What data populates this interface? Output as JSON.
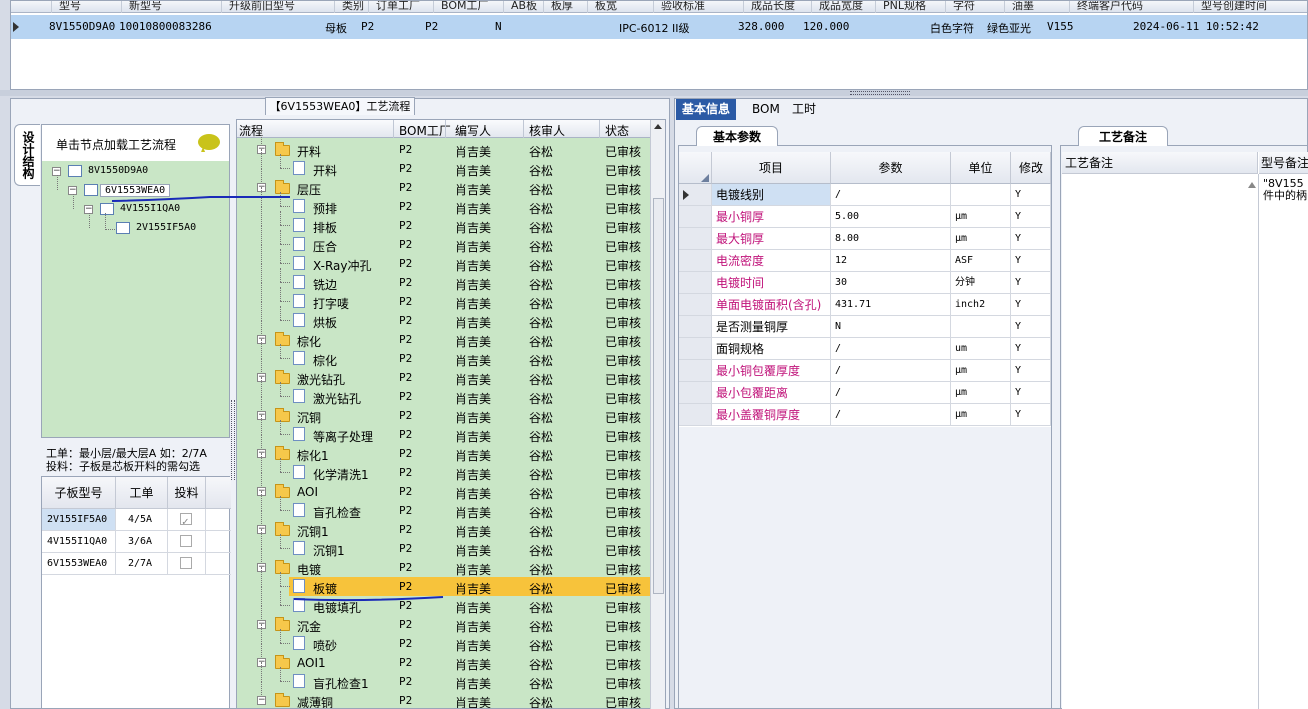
{
  "top_grid": {
    "headers": [
      "型号",
      "新型号",
      "升级前旧型号",
      "类别",
      "订单工厂",
      "BOM工厂",
      "AB板",
      "板厚",
      "板宽",
      "验收标准",
      "成品长度",
      "成品宽度",
      "PNL规格",
      "字符",
      "油墨",
      "终端客户代码",
      "型号创建时间"
    ],
    "row": {
      "model": "8V1550D9A0",
      "new_model": "10010800083286",
      "category": "母板",
      "order_factory": "P2",
      "bom_factory": "P2",
      "ab": "N",
      "standard": "IPC-6012 II级",
      "length": "328.000",
      "width": "120.000",
      "char": "白色字符",
      "ink": "绿色亚光",
      "customer": "V155",
      "created": "2024-06-11 10:52:42"
    }
  },
  "process_tab_title": "【6V1553WEA0】工艺流程",
  "structure_tab": "设计结构",
  "tree": {
    "header": "单击节点加载工艺流程",
    "nodes": [
      "8V1550D9A0",
      "6V1553WEA0",
      "4V155I1QA0",
      "2V155IF5A0"
    ]
  },
  "info_text": [
    "工单：最小层/最大层A 如：2/7A",
    "投料：子板是芯板开料的需勾选"
  ],
  "sub_grid": {
    "headers": [
      "子板型号",
      "工单",
      "投料"
    ],
    "rows": [
      {
        "model": "2V155IF5A0",
        "order": "4/5A",
        "feed": true
      },
      {
        "model": "4V155I1QA0",
        "order": "3/6A",
        "feed": false
      },
      {
        "model": "6V1553WEA0",
        "order": "2/7A",
        "feed": false
      }
    ]
  },
  "process": {
    "headers": [
      "流程",
      "BOM工厂",
      "编写人",
      "核审人",
      "状态"
    ],
    "rows": [
      {
        "name": "开料",
        "lvl": 0,
        "f": "P2",
        "w": "肖吉美",
        "r": "谷松",
        "s": "已审核"
      },
      {
        "name": "开料",
        "lvl": 1,
        "f": "P2",
        "w": "肖吉美",
        "r": "谷松",
        "s": "已审核"
      },
      {
        "name": "层压",
        "lvl": 0,
        "f": "P2",
        "w": "肖吉美",
        "r": "谷松",
        "s": "已审核"
      },
      {
        "name": "预排",
        "lvl": 1,
        "f": "P2",
        "w": "肖吉美",
        "r": "谷松",
        "s": "已审核"
      },
      {
        "name": "排板",
        "lvl": 1,
        "f": "P2",
        "w": "肖吉美",
        "r": "谷松",
        "s": "已审核"
      },
      {
        "name": "压合",
        "lvl": 1,
        "f": "P2",
        "w": "肖吉美",
        "r": "谷松",
        "s": "已审核"
      },
      {
        "name": "X-Ray冲孔",
        "lvl": 1,
        "f": "P2",
        "w": "肖吉美",
        "r": "谷松",
        "s": "已审核"
      },
      {
        "name": "铣边",
        "lvl": 1,
        "f": "P2",
        "w": "肖吉美",
        "r": "谷松",
        "s": "已审核"
      },
      {
        "name": "打字唛",
        "lvl": 1,
        "f": "P2",
        "w": "肖吉美",
        "r": "谷松",
        "s": "已审核"
      },
      {
        "name": "烘板",
        "lvl": 1,
        "f": "P2",
        "w": "肖吉美",
        "r": "谷松",
        "s": "已审核"
      },
      {
        "name": "棕化",
        "lvl": 0,
        "f": "P2",
        "w": "肖吉美",
        "r": "谷松",
        "s": "已审核"
      },
      {
        "name": "棕化",
        "lvl": 1,
        "f": "P2",
        "w": "肖吉美",
        "r": "谷松",
        "s": "已审核"
      },
      {
        "name": "激光钻孔",
        "lvl": 0,
        "f": "P2",
        "w": "肖吉美",
        "r": "谷松",
        "s": "已审核"
      },
      {
        "name": "激光钻孔",
        "lvl": 1,
        "f": "P2",
        "w": "肖吉美",
        "r": "谷松",
        "s": "已审核"
      },
      {
        "name": "沉铜",
        "lvl": 0,
        "f": "P2",
        "w": "肖吉美",
        "r": "谷松",
        "s": "已审核"
      },
      {
        "name": "等离子处理",
        "lvl": 1,
        "f": "P2",
        "w": "肖吉美",
        "r": "谷松",
        "s": "已审核"
      },
      {
        "name": "棕化1",
        "lvl": 0,
        "f": "P2",
        "w": "肖吉美",
        "r": "谷松",
        "s": "已审核"
      },
      {
        "name": "化学清洗1",
        "lvl": 1,
        "f": "P2",
        "w": "肖吉美",
        "r": "谷松",
        "s": "已审核"
      },
      {
        "name": "AOI",
        "lvl": 0,
        "f": "P2",
        "w": "肖吉美",
        "r": "谷松",
        "s": "已审核"
      },
      {
        "name": "盲孔检查",
        "lvl": 1,
        "f": "P2",
        "w": "肖吉美",
        "r": "谷松",
        "s": "已审核"
      },
      {
        "name": "沉铜1",
        "lvl": 0,
        "f": "P2",
        "w": "肖吉美",
        "r": "谷松",
        "s": "已审核"
      },
      {
        "name": "沉铜1",
        "lvl": 1,
        "f": "P2",
        "w": "肖吉美",
        "r": "谷松",
        "s": "已审核"
      },
      {
        "name": "电镀",
        "lvl": 0,
        "f": "P2",
        "w": "肖吉美",
        "r": "谷松",
        "s": "已审核"
      },
      {
        "name": "板镀",
        "lvl": 1,
        "f": "P2",
        "w": "肖吉美",
        "r": "谷松",
        "s": "已审核",
        "sel": true
      },
      {
        "name": "电镀填孔",
        "lvl": 1,
        "f": "P2",
        "w": "肖吉美",
        "r": "谷松",
        "s": "已审核"
      },
      {
        "name": "沉金",
        "lvl": 0,
        "f": "P2",
        "w": "肖吉美",
        "r": "谷松",
        "s": "已审核"
      },
      {
        "name": "喷砂",
        "lvl": 1,
        "f": "P2",
        "w": "肖吉美",
        "r": "谷松",
        "s": "已审核"
      },
      {
        "name": "AOI1",
        "lvl": 0,
        "f": "P2",
        "w": "肖吉美",
        "r": "谷松",
        "s": "已审核"
      },
      {
        "name": "盲孔检查1",
        "lvl": 1,
        "f": "P2",
        "w": "肖吉美",
        "r": "谷松",
        "s": "已审核"
      },
      {
        "name": "减薄铜",
        "lvl": 0,
        "f": "P2",
        "w": "肖吉美",
        "r": "谷松",
        "s": "已审核"
      }
    ]
  },
  "right_tabs": [
    "基本信息",
    "BOM",
    "工时"
  ],
  "basic_title": "基本参数",
  "remark_title": "工艺备注",
  "params": {
    "headers": [
      "项目",
      "参数",
      "单位",
      "修改"
    ],
    "rows": [
      {
        "item": "电镀线别",
        "value": "/",
        "unit": "",
        "mod": "Y",
        "pink": false,
        "sel": true
      },
      {
        "item": "最小铜厚",
        "value": "5.00",
        "unit": "μm",
        "mod": "Y",
        "pink": true
      },
      {
        "item": "最大铜厚",
        "value": "8.00",
        "unit": "μm",
        "mod": "Y",
        "pink": true
      },
      {
        "item": "电流密度",
        "value": "12",
        "unit": "ASF",
        "mod": "Y",
        "pink": true
      },
      {
        "item": "电镀时间",
        "value": "30",
        "unit": "分钟",
        "mod": "Y",
        "pink": true
      },
      {
        "item": "单面电镀面积(含孔)",
        "value": "431.71",
        "unit": "inch2",
        "mod": "Y",
        "pink": true
      },
      {
        "item": "是否测量铜厚",
        "value": "N",
        "unit": "",
        "mod": "Y",
        "pink": false
      },
      {
        "item": "面铜规格",
        "value": "/",
        "unit": "um",
        "mod": "Y",
        "pink": false
      },
      {
        "item": "最小铜包覆厚度",
        "value": "/",
        "unit": "μm",
        "mod": "Y",
        "pink": true
      },
      {
        "item": "最小包覆距离",
        "value": "/",
        "unit": "μm",
        "mod": "Y",
        "pink": true
      },
      {
        "item": "最小盖覆铜厚度",
        "value": "/",
        "unit": "μm",
        "mod": "Y",
        "pink": true
      }
    ]
  },
  "remark": {
    "col1": "工艺备注",
    "col2": "型号备注",
    "text": "\"8V155\n件中的柄"
  },
  "colors": {
    "selection": "#f7c33b",
    "tree_bg": "#c9e6c6",
    "pink_text": "#c0137a",
    "tab_active": "#2b5aa5"
  }
}
